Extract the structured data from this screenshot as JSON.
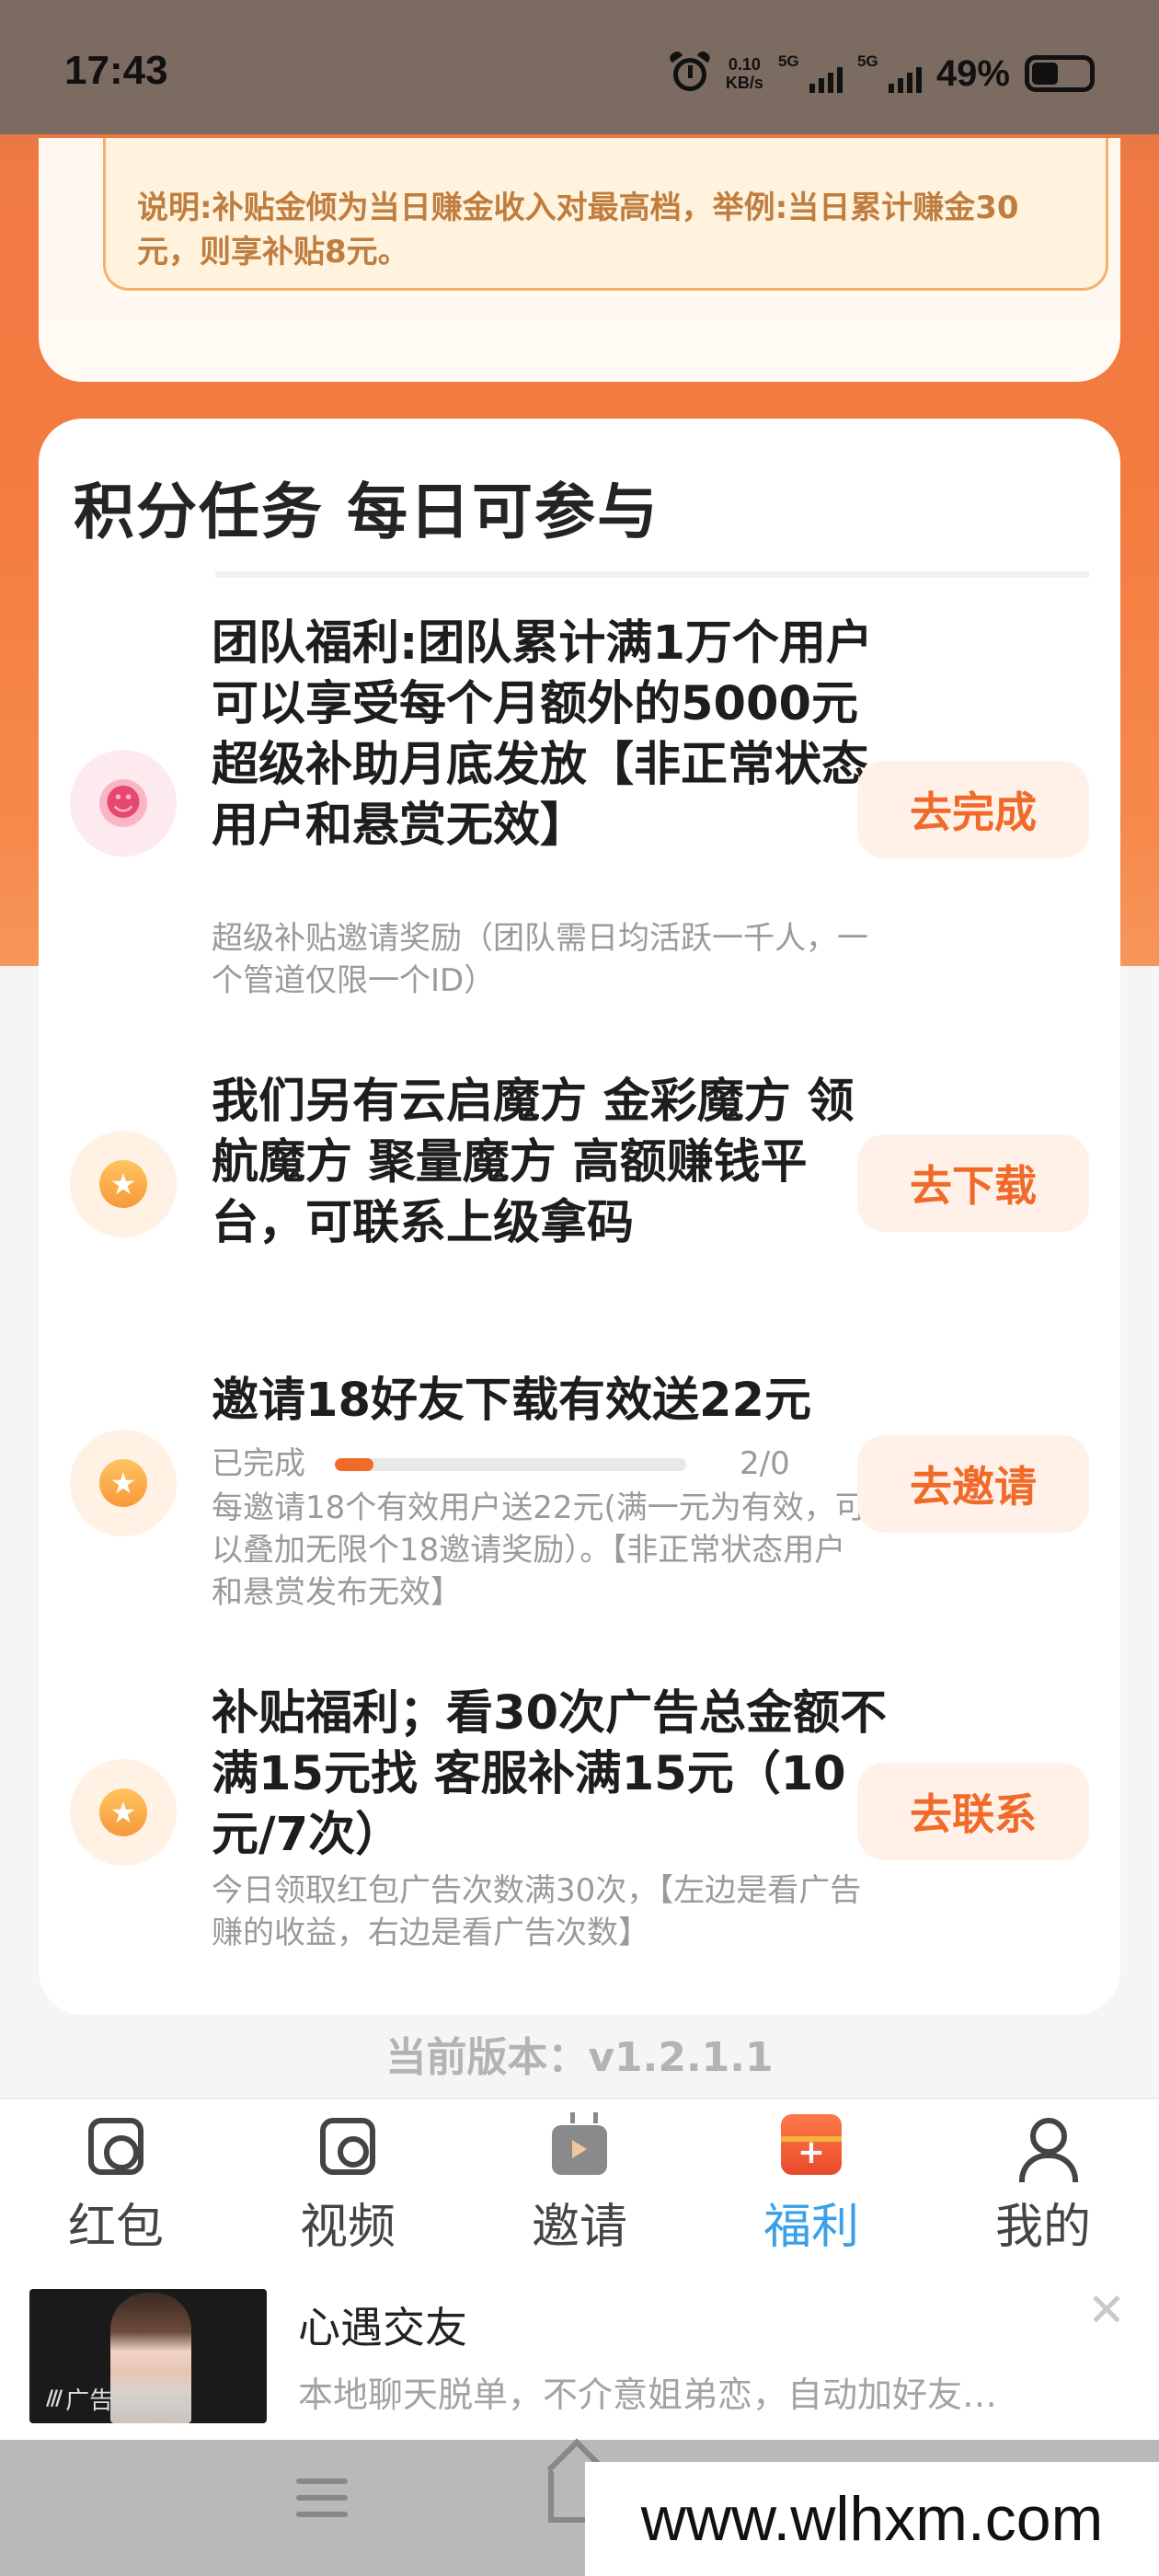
{
  "status_bar": {
    "time": "17:43",
    "net_speed_value": "0.10",
    "net_speed_unit": "KB/s",
    "sim1_tag": "5G",
    "sim2_tag": "5G",
    "battery_pct": "49%",
    "battery_level": 0.49
  },
  "notice": {
    "text": "说明:补贴金倾为当日赚金收入对最高档，举例:当日累计赚金30元，则享补贴8元。"
  },
  "tasks_section": {
    "title": "积分任务  每日可参与",
    "tasks": [
      {
        "icon": "user-icon",
        "title": "团队福利:团队累计满1万个用户可以享受每个月额外的5000元超级补助月底发放【非正常状态用户和悬赏无效】",
        "desc": "超级补贴邀请奖励（团队需日均活跃一千人，一个管道仅限一个ID）",
        "button": "去完成"
      },
      {
        "icon": "star-coin-icon",
        "title": "我们另有云启魔方 金彩魔方 领航魔方 聚量魔方 高额赚钱平台，可联系上级拿码",
        "desc": "",
        "button": "去下载"
      },
      {
        "icon": "star-coin-icon",
        "title": "邀请18好友下载有效送22元",
        "progress_label": "已完成",
        "progress_count": "2/0",
        "progress_fraction": 0.11,
        "desc": "每邀请18个有效用户送22元(满一元为有效，可以叠加无限个18邀请奖励）。【非正常状态用户和悬赏发布无效】",
        "button": "去邀请"
      },
      {
        "icon": "star-coin-icon",
        "title": "补贴福利；看30次广告总金额不满15元找 客服补满15元（10元/7次）",
        "desc": "今日领取红包广告次数满30次，【左边是看广告赚的收益，右边是看广告次数】",
        "button": "去联系"
      }
    ]
  },
  "version": "当前版本：v1.2.1.1",
  "bottom_nav": {
    "items": [
      {
        "label": "红包",
        "icon": "red-packet-icon",
        "active": false
      },
      {
        "label": "视频",
        "icon": "video-icon",
        "active": false
      },
      {
        "label": "邀请",
        "icon": "tv-icon",
        "active": false
      },
      {
        "label": "福利",
        "icon": "gift-icon",
        "active": true
      },
      {
        "label": "我的",
        "icon": "profile-icon",
        "active": false
      }
    ],
    "active_color": "#3aa0e8"
  },
  "ad": {
    "badge": "广告",
    "title": "心遇交友",
    "desc": "本地聊天脱单，不介意姐弟恋，自动加好友…"
  },
  "watermark": "www.wlhxm.com",
  "colors": {
    "accent": "#f06a2a",
    "button_bg": "#fff1e8",
    "background_orange": "#f47b40"
  }
}
